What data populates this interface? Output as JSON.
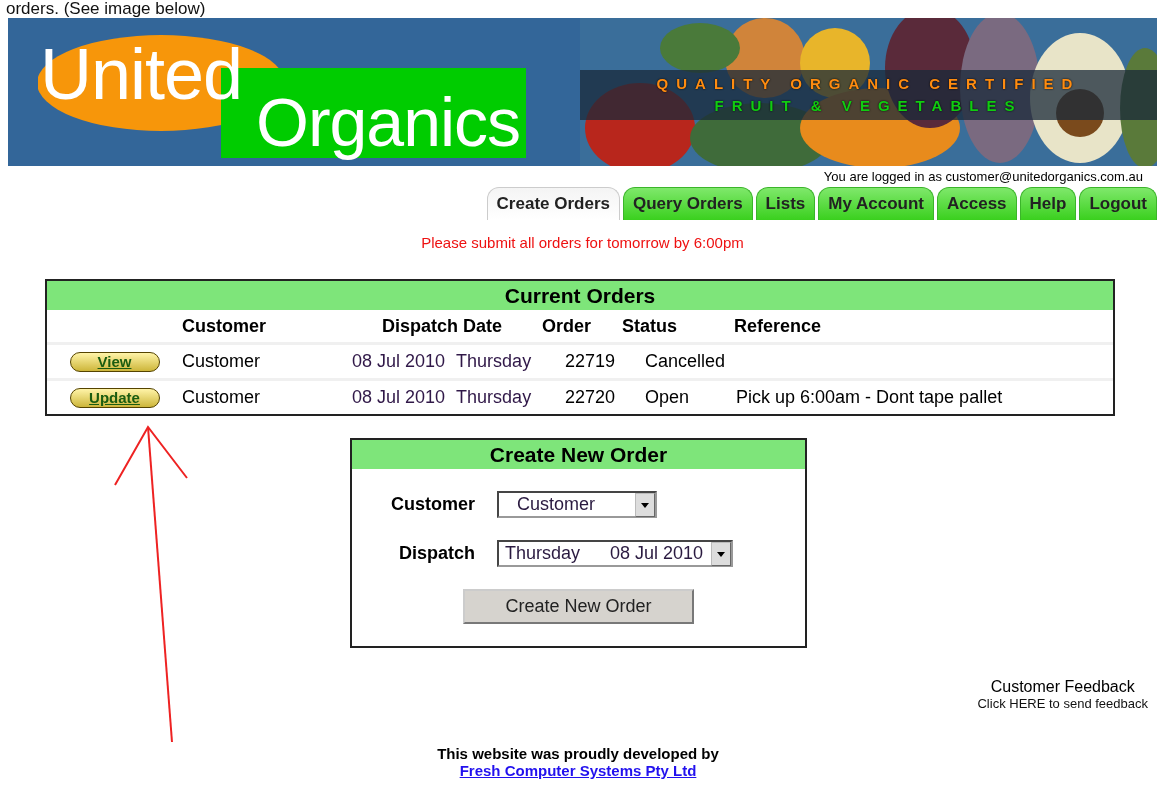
{
  "intro_text": "orders. (See image below)",
  "banner": {
    "logo_word_1": "United",
    "logo_word_2": "Organics",
    "tagline_1": "QUALITY ORGANIC CERTIFIED",
    "tagline_2": "FRUIT & VEGETABLES"
  },
  "login_text": "You are logged in as customer@unitedorganics.com.au",
  "tabs": [
    {
      "label": "Create Orders",
      "selected": true
    },
    {
      "label": "Query Orders",
      "selected": false
    },
    {
      "label": "Lists",
      "selected": false
    },
    {
      "label": "My Account",
      "selected": false
    },
    {
      "label": "Access",
      "selected": false
    },
    {
      "label": "Help",
      "selected": false
    },
    {
      "label": "Logout",
      "selected": false
    }
  ],
  "notice": "Please submit all orders for tomorrow by 6:00pm",
  "current_orders": {
    "title": "Current Orders",
    "columns": [
      "Customer",
      "Dispatch Date",
      "Order",
      "Status",
      "Reference"
    ],
    "rows": [
      {
        "action": "View",
        "customer": "Customer",
        "date": "08 Jul 2010",
        "day": "Thursday",
        "order": "22719",
        "status": "Cancelled"
      },
      {
        "action": "Update",
        "customer": "Customer",
        "date": "08 Jul 2010",
        "day": "Thursday",
        "order": "22720",
        "status": "Open",
        "reference": "Pick up 6:00am - Dont tape pallet"
      }
    ]
  },
  "create_order": {
    "title": "Create New Order",
    "fields": [
      {
        "label": "Customer",
        "values": [
          "Customer"
        ]
      },
      {
        "label": "Dispatch",
        "values": [
          "Thursday",
          "08 Jul 2010"
        ]
      }
    ],
    "button": "Create New Order"
  },
  "feedback": {
    "title": "Customer Feedback",
    "link": "Click HERE to send feedback"
  },
  "footer": {
    "text": "This website was proudly developed by",
    "link": "Fresh Computer Systems Pty Ltd"
  }
}
